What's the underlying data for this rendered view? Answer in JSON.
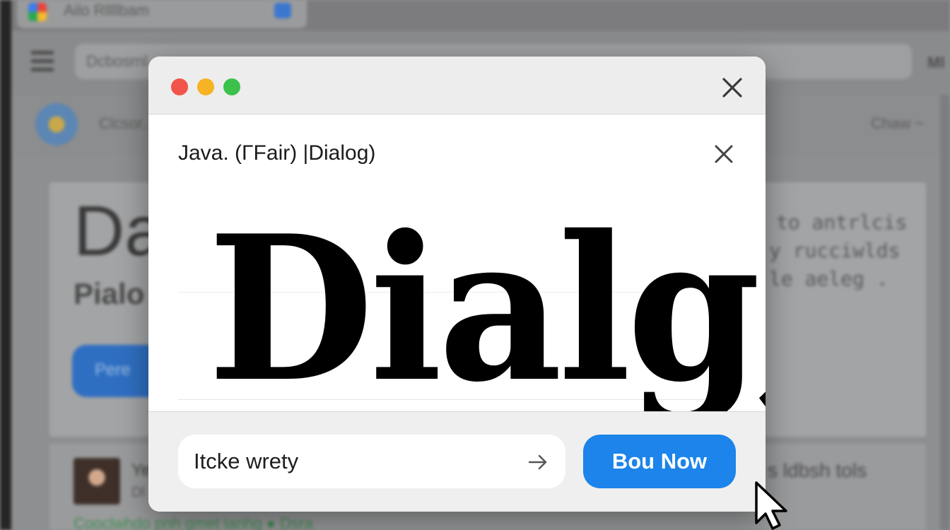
{
  "background": {
    "tab": {
      "title": "Ailo Rllllbam"
    },
    "addressbar": {
      "text": "Dcbosrnl... ..."
    },
    "toolbar_right": "Ml",
    "header": {
      "text": "Clcsor...",
      "right_text": "Chaw ~"
    },
    "hero": {
      "heading": "Da",
      "subheading": "Pialo",
      "button_label": "Pere"
    },
    "right_text": [
      "to antrlcis",
      "y rucciwlds",
      "le aeleg ."
    ],
    "feed": {
      "name": "Ye",
      "subtitle": "Dl",
      "right_text": "s ldbsh tols",
      "link_text": "Cooclwhdo pnh gmet lanhg ● Dsra"
    }
  },
  "dialog": {
    "traffic_lights": {
      "red": "#f2534a",
      "yellow": "#f6b323",
      "green": "#3cc14a"
    },
    "title": "Java. (ΓFair) |Dialog)",
    "big_text": "Dialg,",
    "input_value": "Itcke wrety",
    "input_icon": "arrow-right-icon",
    "button_label": "Bou Now",
    "button_color": "#1c84ea"
  },
  "cursor": "arrow-cursor-icon"
}
